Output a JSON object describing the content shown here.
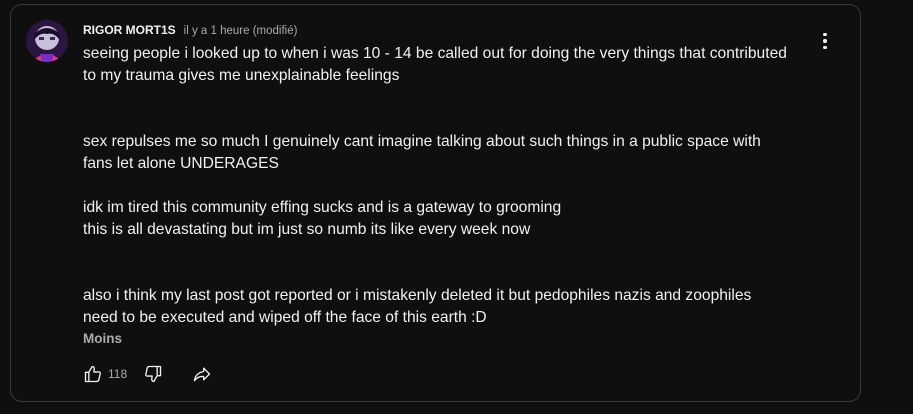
{
  "comment": {
    "author": "RIGOR MORT1S",
    "timestamp": "il y a 1 heure (modifié)",
    "lines": [
      "seeing people i looked up to when i was 10 - 14 be called out for doing the very things that contributed",
      "to my trauma gives me unexplainable feelings",
      "",
      "",
      "sex repulses me so much I genuinely cant imagine talking about such things in a public space with",
      "fans let alone UNDERAGES",
      "",
      "idk im tired this community effing sucks and is a gateway to grooming",
      "this is all devastating but im just so numb its like every week now",
      "",
      "",
      "also i think my last post got reported or i mistakenly deleted it but pedophiles nazis and zoophiles",
      "need to be executed and wiped off the face of this earth :D"
    ],
    "read_less_label": "Moins",
    "like_count": "118"
  },
  "icons": {
    "like": "thumbs-up-icon",
    "dislike": "thumbs-down-icon",
    "share": "share-arrow-icon",
    "more": "more-vertical-icon"
  },
  "colors": {
    "background": "#0f0f0f",
    "border": "#3a3a3a",
    "text": "#f1f1f1",
    "secondary_text": "#aaaaaa"
  }
}
